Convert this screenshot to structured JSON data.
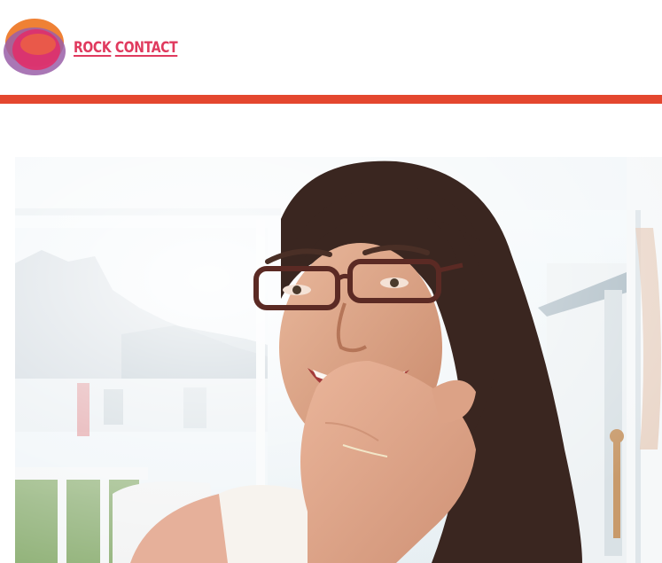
{
  "header": {
    "brand_word_1": "ROCK",
    "brand_word_2": "CONTACT",
    "logo_icon": "overlapping-circles-logo-icon"
  },
  "colors": {
    "accent_bar": "#e4472f",
    "brand_text": "#e03a5e",
    "logo_orange": "#ee7a2a",
    "logo_pink": "#e02f6a",
    "logo_purple": "#9a5fa8"
  },
  "hero": {
    "image": "photo-of-smiling-woman-with-glasses-waving"
  }
}
